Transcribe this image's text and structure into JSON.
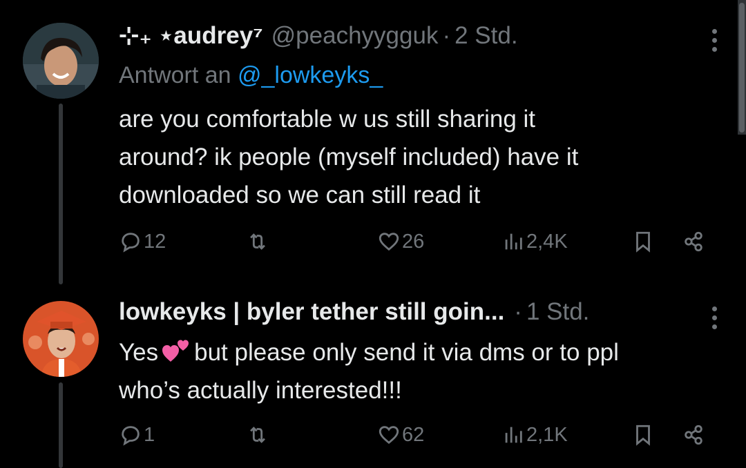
{
  "tweets": [
    {
      "display_name": "⊹₊ ⋆audrey⁷",
      "handle": "@peachyygguk",
      "separator": "·",
      "time": "2 Std.",
      "reply_prefix": "Antwort an",
      "reply_mention": "@_lowkeyks_",
      "lines": [
        "are you comfortable w us still sharing it",
        "around? ik people (myself included) have it",
        "downloaded so we can still read it"
      ],
      "actions": {
        "replies": "12",
        "retweets": "",
        "likes": "26",
        "views": "2,4K"
      },
      "avatar_icon": "avatar-boy-smiling"
    },
    {
      "display_name": "lowkeyks | byler tether still goin...",
      "separator": "·",
      "time": "1 Std.",
      "line1_before": "Yes",
      "line1_after": "but please only send it via dms or to ppl",
      "emoji_icon": "two-hearts-emoji",
      "line2": "who’s actually interested!!!",
      "actions": {
        "replies": "1",
        "retweets": "",
        "likes": "62",
        "views": "2,1K"
      },
      "avatar_icon": "avatar-graduation-cap"
    }
  ],
  "colors": {
    "background": "#000000",
    "text": "#e7e9ea",
    "muted": "#71767b",
    "link": "#1d9bf0",
    "emoji_heart": "#f35fa6"
  }
}
